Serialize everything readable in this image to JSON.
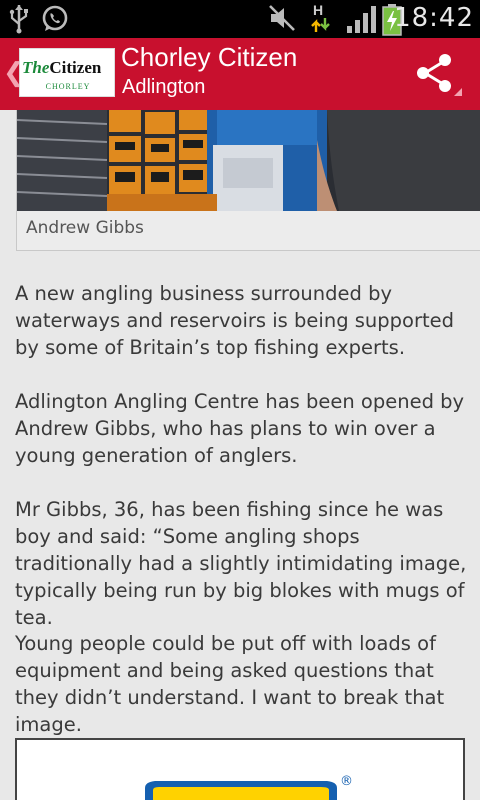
{
  "status_bar": {
    "time": "18:42",
    "network_label": "H",
    "icons": [
      "usb-icon",
      "whatsapp-icon",
      "mute-icon",
      "data-arrows-icon",
      "signal-icon",
      "battery-charging-icon"
    ]
  },
  "action_bar": {
    "logo_the": "The",
    "logo_citizen": "Citizen",
    "logo_sub": "CHORLEY",
    "title": "Chorley Citizen",
    "subtitle": "Adlington",
    "share_icon": "share-icon"
  },
  "article": {
    "photo_caption": "Andrew Gibbs",
    "paragraphs": [
      "A new angling business surrounded by waterways and reservoirs is being supported by some of Britain’s top fishing experts.",
      "Adlington Angling Centre has been opened by Andrew Gibbs, who has plans to win over a young generation of anglers.",
      "Mr Gibbs, 36, has been fishing since he was boy and said: “Some angling shops traditionally had a slightly intimidating image, typically being run by big blokes with mugs of tea.",
      "Young people could be put off with loads of equipment and being asked questions that they didn’t understand. I want to break that image."
    ]
  },
  "ad": {
    "registered_mark": "®"
  },
  "colors": {
    "brand_red": "#c8102e",
    "logo_green": "#1b8a3a",
    "content_bg": "#e8e8e8",
    "body_text": "#3a3a3a"
  }
}
